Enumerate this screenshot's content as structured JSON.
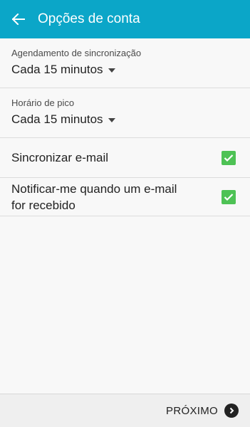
{
  "header": {
    "title": "Opções de conta",
    "back_icon": "arrow-left-icon",
    "background": "#0ba6c8"
  },
  "settings": {
    "sync_schedule": {
      "label": "Agendamento de sincronização",
      "value": "Cada 15 minutos"
    },
    "peak_time": {
      "label": "Horário de pico",
      "value": "Cada 15 minutos"
    },
    "sync_email": {
      "label": "Sincronizar e-mail",
      "checked": true
    },
    "notify": {
      "label_line1": "Notificar-me quando um e-mail",
      "label_line2": "for recebido",
      "checked": true
    }
  },
  "footer": {
    "next_label": "PRÓXIMO",
    "next_icon": "chevron-right-circle-icon"
  },
  "colors": {
    "checkbox": "#4ec255"
  }
}
